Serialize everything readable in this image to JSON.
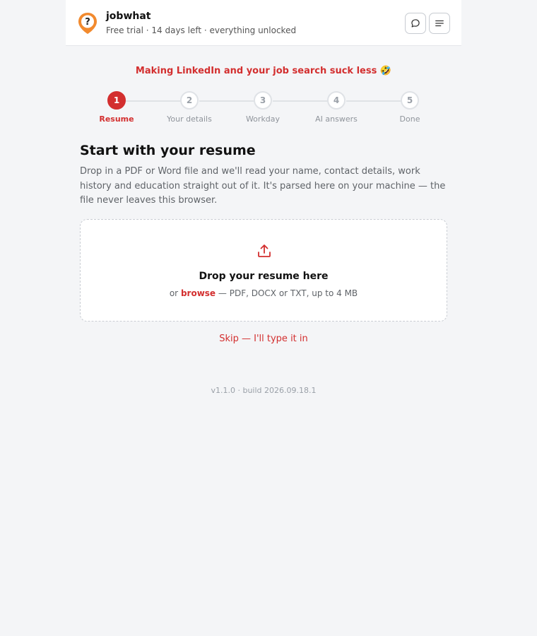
{
  "header": {
    "app_name": "jobwhat",
    "subtitle": "Free trial · 14 days left · everything unlocked",
    "chat_icon": "chat-bubble-icon",
    "menu_icon": "menu-icon"
  },
  "tagline": "Making LinkedIn and your job search suck less 🤣",
  "steps": [
    {
      "number": "1",
      "label": "Resume",
      "active": true
    },
    {
      "number": "2",
      "label": "Your details",
      "active": false
    },
    {
      "number": "3",
      "label": "Workday",
      "active": false
    },
    {
      "number": "4",
      "label": "AI answers",
      "active": false
    },
    {
      "number": "5",
      "label": "Done",
      "active": false
    }
  ],
  "main": {
    "title": "Start with your resume",
    "description": "Drop in a PDF or Word file and we'll read your name, contact details, work history and education straight out of it. It's parsed here on your machine — the file never leaves this browser."
  },
  "dropzone": {
    "icon": "upload-icon",
    "title": "Drop your resume here",
    "sub_prefix": "or",
    "browse": "browse",
    "sub_suffix": "— PDF, DOCX or TXT, up to 4 MB"
  },
  "skip_label": "Skip — I'll type it in",
  "version": "v1.1.0 · build 2026.09.18.1",
  "colors": {
    "accent": "#d32f2f",
    "logo": "#f28a2e",
    "background": "#f4f5f7"
  }
}
